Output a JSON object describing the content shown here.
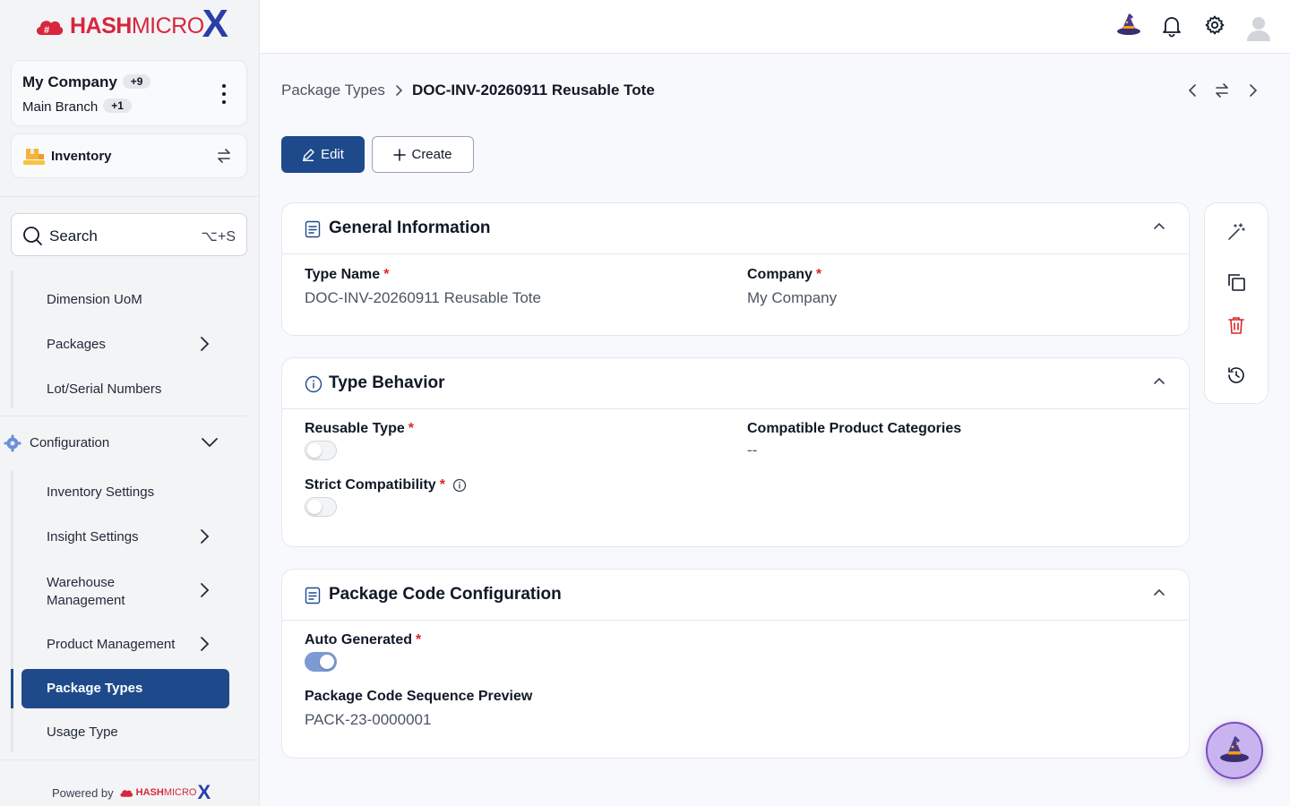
{
  "brand": {
    "name_hash": "HASH",
    "name_micro": "MICRO",
    "name_x": "X",
    "powered_by": "Powered by"
  },
  "company": {
    "name": "My Company",
    "company_extra": "+9",
    "branch": "Main Branch",
    "branch_extra": "+1"
  },
  "module": {
    "label": "Inventory"
  },
  "search": {
    "label": "Search",
    "shortcut": "⌥+S"
  },
  "sidebar": {
    "items_top": [
      {
        "label": "Dimension UoM"
      },
      {
        "label": "Packages"
      },
      {
        "label": "Lot/Serial Numbers"
      }
    ],
    "configuration_label": "Configuration",
    "config_items": [
      {
        "label": "Inventory Settings"
      },
      {
        "label": "Insight Settings"
      },
      {
        "label": "Warehouse Management"
      },
      {
        "label": "Product Management"
      },
      {
        "label": "Package Types"
      },
      {
        "label": "Usage Type"
      }
    ]
  },
  "breadcrumb": {
    "parent": "Package Types",
    "current": "DOC-INV-20260911 Reusable Tote"
  },
  "actions": {
    "edit": "Edit",
    "create": "Create"
  },
  "general": {
    "title": "General Information",
    "type_name_label": "Type Name",
    "type_name_value": "DOC-INV-20260911 Reusable Tote",
    "company_label": "Company",
    "company_value": "My Company"
  },
  "behavior": {
    "title": "Type Behavior",
    "reusable_label": "Reusable Type",
    "reusable_on": false,
    "categories_label": "Compatible Product Categories",
    "categories_value": "--",
    "strict_label": "Strict Compatibility",
    "strict_on": false
  },
  "package_code": {
    "title": "Package Code Configuration",
    "auto_label": "Auto Generated",
    "auto_on": true,
    "preview_label": "Package Code Sequence Preview",
    "preview_value": "PACK-23-0000001"
  },
  "required_mark": "*",
  "colors": {
    "primary": "#1e4a8c",
    "brand_red": "#d7263d",
    "brand_blue": "#2b3ea8",
    "danger": "#dc2626"
  }
}
